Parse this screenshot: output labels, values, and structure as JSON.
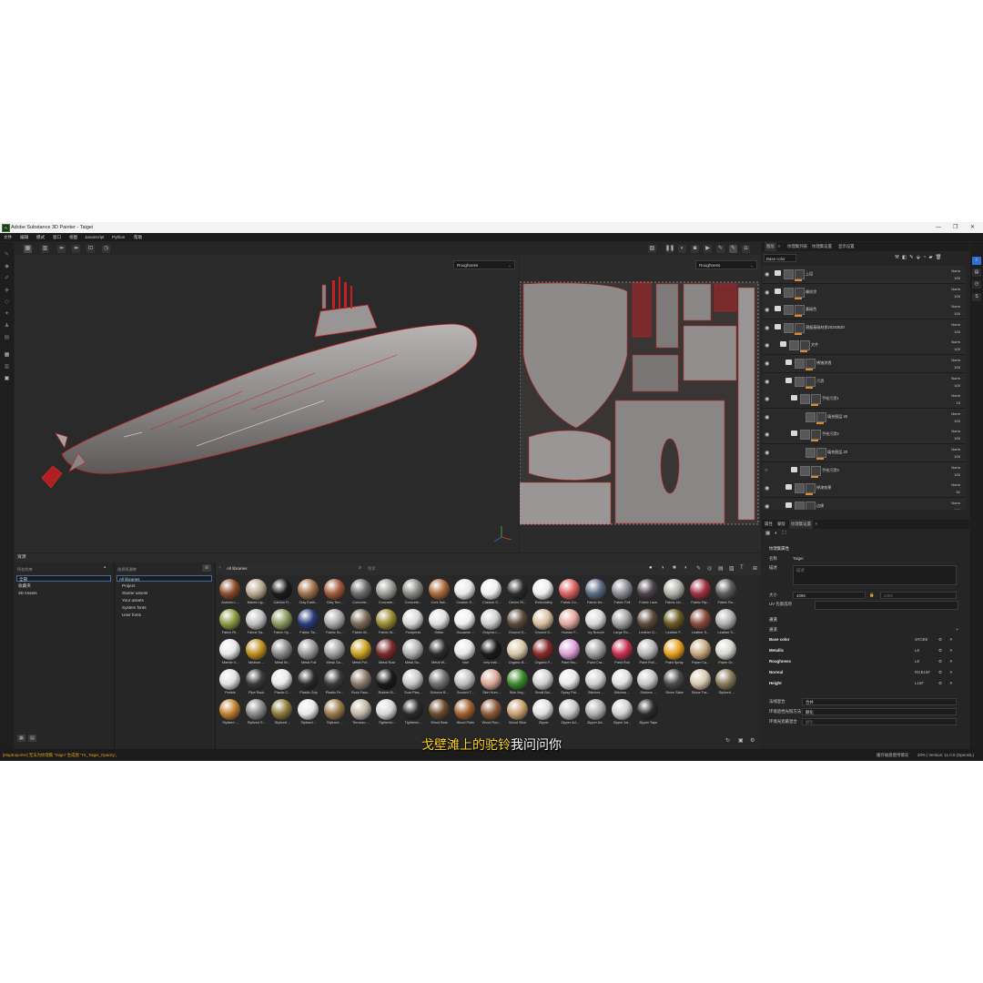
{
  "window": {
    "title": "Adobe Substance 3D Painter - Taigei",
    "logo": "Pt",
    "controls": [
      "—",
      "❐",
      "✕"
    ]
  },
  "menu": [
    "文件",
    "编辑",
    "模式",
    "窗口",
    "视图",
    "JavaScript",
    "Python",
    "帮助"
  ],
  "viewport": {
    "left_channel": "Roughness",
    "right_channel": "Roughness"
  },
  "layers_panel": {
    "tabs": [
      "图层",
      "纹理集列表",
      "纹理集设置",
      "显示设置"
    ],
    "channel": "Base color",
    "layers": [
      {
        "name": "上层",
        "blend": "Norm",
        "opacity": "100"
      },
      {
        "name": "栅纹涂",
        "blend": "Norm",
        "opacity": "100"
      },
      {
        "name": "基础色",
        "blend": "Norm",
        "opacity": "100"
      },
      {
        "name": "潜艇基础材质20240520",
        "blend": "Norm",
        "opacity": "100"
      },
      {
        "name": "文件",
        "blend": "Norm",
        "opacity": "100"
      },
      {
        "name": "锈蚀渗透",
        "blend": "Norm",
        "opacity": "100"
      },
      {
        "name": "污渍",
        "blend": "Norm",
        "opacity": "100"
      },
      {
        "name": "手绘污渍1",
        "blend": "Norm",
        "opacity": "10"
      },
      {
        "name": "填充图层 20",
        "blend": "Norm",
        "opacity": "100"
      },
      {
        "name": "手绘污渍2",
        "blend": "Norm",
        "opacity": "100"
      },
      {
        "name": "填充图层 20",
        "blend": "Norm",
        "opacity": "100"
      },
      {
        "name": "手绘污渍3",
        "blend": "Norm",
        "opacity": "100"
      },
      {
        "name": "掉漆效果",
        "blend": "Norm",
        "opacity": "51"
      },
      {
        "name": "边缘",
        "blend": "Norm",
        "opacity": "100"
      }
    ]
  },
  "texture_set": {
    "tabs": [
      "属性",
      "蒙版",
      "纹理集设置"
    ],
    "section_title": "纹理集属性",
    "name_label": "名称",
    "name_value": "Taigei",
    "desc_label": "描述",
    "desc_placeholder": "描述",
    "size_label": "大小",
    "size_value": "4096",
    "size_value2": "4096",
    "uv_label": "UV 包裹选项",
    "channels_title": "通道",
    "channels_sub": "通道",
    "channels": [
      {
        "name": "Base color",
        "format": "sRGB8"
      },
      {
        "name": "Metallic",
        "format": "L8"
      },
      {
        "name": "Roughness",
        "format": "L8"
      },
      {
        "name": "Normal",
        "format": "RGB16F"
      },
      {
        "name": "Height",
        "format": "L16F"
      }
    ],
    "opt1_label": "法线混合",
    "opt1_value": "合并",
    "opt2_label": "环境遮挡光照方法",
    "opt2_value": "颠化",
    "opt3_label": "环境光遮蔽混合",
    "opt3_value": "颠化"
  },
  "assets": {
    "panel_title": "资源",
    "col1_head": "所在的库",
    "col1_items": [
      "全部",
      "收藏夹",
      "3D Assets"
    ],
    "col2_head": "选择资源库",
    "col2_items": [
      "All libraries",
      "Project",
      "Starter assets",
      "Your assets",
      "System fonts",
      "User fonts"
    ],
    "breadcrumb": "All libraries",
    "search_placeholder": "搜索",
    "materials": [
      {
        "label": "Autumn L...",
        "color": "#8a4a2a"
      },
      {
        "label": "Baked Lig...",
        "color": "#b8a890"
      },
      {
        "label": "Carbon Fi...",
        "color": "#1a1a1a"
      },
      {
        "label": "Clay Earth...",
        "color": "#a0704a"
      },
      {
        "label": "Clay Terr...",
        "color": "#a0583a"
      },
      {
        "label": "Concrete...",
        "color": "#6a6a6a"
      },
      {
        "label": "Concrete...",
        "color": "#9a9a94"
      },
      {
        "label": "Concrete...",
        "color": "#8a8a84"
      },
      {
        "label": "Cork Nat...",
        "color": "#a8683a"
      },
      {
        "label": "Custom S...",
        "color": "#e8e8e8"
      },
      {
        "label": "Custom S...",
        "color": "#f0f0f0"
      },
      {
        "label": "Denim Ri...",
        "color": "#2a2a2a"
      },
      {
        "label": "Embroidery",
        "color": "#eeeeee"
      },
      {
        "label": "Fabric Co...",
        "color": "#d86060"
      },
      {
        "label": "Fabric De...",
        "color": "#5a6a80"
      },
      {
        "label": "Fabric Felt",
        "color": "#8a8a94"
      },
      {
        "label": "Fabric Lace",
        "color": "#4a4248"
      },
      {
        "label": "Fabric Lin...",
        "color": "#b0b0a8"
      },
      {
        "label": "Fabric Rip...",
        "color": "#a03040"
      },
      {
        "label": "Fabric Ro...",
        "color": "#5a5a5a"
      },
      {
        "label": "Fabric Ri...",
        "color": "#8a9a40"
      },
      {
        "label": "Fabric Sa...",
        "color": "#c0c0c0"
      },
      {
        "label": "Fabric Sp...",
        "color": "#8a9a60"
      },
      {
        "label": "Fabric Tw...",
        "color": "#2a3a7a"
      },
      {
        "label": "Fabric Sc...",
        "color": "#aaaaaa"
      },
      {
        "label": "Fabric W...",
        "color": "#7a6a5a"
      },
      {
        "label": "Fabric W...",
        "color": "#9a8a30"
      },
      {
        "label": "Footprints",
        "color": "#d8d8d8"
      },
      {
        "label": "Glitter",
        "color": "#e0e0e0"
      },
      {
        "label": "Gouache ...",
        "color": "#f0f0f0"
      },
      {
        "label": "Graphic L...",
        "color": "#d0d0d0"
      },
      {
        "label": "Ground G...",
        "color": "#5a4a3a"
      },
      {
        "label": "Ground S...",
        "color": "#d8c0a0"
      },
      {
        "label": "Human F...",
        "color": "#e0a8a0"
      },
      {
        "label": "Ivy Branch",
        "color": "#d8d8d8"
      },
      {
        "label": "Large Ro...",
        "color": "#a0a0a0"
      },
      {
        "label": "Leather G...",
        "color": "#5a4a3a"
      },
      {
        "label": "Leather F...",
        "color": "#6a5a20"
      },
      {
        "label": "Leather S...",
        "color": "#8a4a3a"
      },
      {
        "label": "Leather S...",
        "color": "#b0b0b0"
      },
      {
        "label": "Marble V...",
        "color": "#e8e8e8"
      },
      {
        "label": "Medium ...",
        "color": "#c09020"
      },
      {
        "label": "Metal Br...",
        "color": "#8a8a8a"
      },
      {
        "label": "Metal Foil",
        "color": "#9a9a9a"
      },
      {
        "label": "Metal Ga...",
        "color": "#a0a0a0"
      },
      {
        "label": "Metal Pol...",
        "color": "#c8a020"
      },
      {
        "label": "Metal Rust",
        "color": "#7a2a2a"
      },
      {
        "label": "Metal Sa...",
        "color": "#b0b0b0"
      },
      {
        "label": "Metal W...",
        "color": "#2a2a2a"
      },
      {
        "label": "Nail",
        "color": "#e8e8e8"
      },
      {
        "label": "new mat...",
        "color": "#1a1a1a"
      },
      {
        "label": "Organic B...",
        "color": "#d8c8a8"
      },
      {
        "label": "Organic F...",
        "color": "#8a2a2a"
      },
      {
        "label": "Paint Bru...",
        "color": "#e0a0d8"
      },
      {
        "label": "Paint Cra...",
        "color": "#a0a0a0"
      },
      {
        "label": "Paint Roll",
        "color": "#c83050"
      },
      {
        "label": "Paint Roll...",
        "color": "#b8b8b8"
      },
      {
        "label": "Paint Spray",
        "color": "#e8a020"
      },
      {
        "label": "Paper Ca...",
        "color": "#c8a880"
      },
      {
        "label": "Paper Gr...",
        "color": "#d8d8d0"
      },
      {
        "label": "Pebble",
        "color": "#e0e0e0"
      },
      {
        "label": "Pipe Rack",
        "color": "#3a3a3a"
      },
      {
        "label": "Plastic C...",
        "color": "#e8e8e8"
      },
      {
        "label": "Plastic Grip",
        "color": "#2a2a2a"
      },
      {
        "label": "Plastic Fe...",
        "color": "#3a3a3a"
      },
      {
        "label": "Rock Fasc...",
        "color": "#8a7a6a"
      },
      {
        "label": "Rubber B...",
        "color": "#1a1a1a"
      },
      {
        "label": "Scar Plas...",
        "color": "#c8c8c8"
      },
      {
        "label": "Science B...",
        "color": "#707070"
      },
      {
        "label": "Scratch T...",
        "color": "#c0c0c0"
      },
      {
        "label": "Skin Hum...",
        "color": "#d8a898"
      },
      {
        "label": "Skin Veg...",
        "color": "#3a8a2a"
      },
      {
        "label": "Small Bol...",
        "color": "#d0d0d0"
      },
      {
        "label": "Spray Pai...",
        "color": "#e8e8e8"
      },
      {
        "label": "Stitches ...",
        "color": "#d0d0d0"
      },
      {
        "label": "Stitches ...",
        "color": "#e0e0e0"
      },
      {
        "label": "Stickers ...",
        "color": "#c8c8c8"
      },
      {
        "label": "Stone Slate",
        "color": "#4a4a4a"
      },
      {
        "label": "Stone Tra...",
        "color": "#d8c8b0"
      },
      {
        "label": "Stylized ...",
        "color": "#8a7a5a"
      },
      {
        "label": "Stylized ...",
        "color": "#c08030"
      },
      {
        "label": "Stylized S...",
        "color": "#8a8a8a"
      },
      {
        "label": "Stylized ...",
        "color": "#8a7a3a"
      },
      {
        "label": "Stylized ...",
        "color": "#e8e8e8"
      },
      {
        "label": "Stylized ...",
        "color": "#9a7a4a"
      },
      {
        "label": "Terrazzo ...",
        "color": "#c0b8a8"
      },
      {
        "label": "Tightenin...",
        "color": "#d8d8d8"
      },
      {
        "label": "Tightenin...",
        "color": "#2a2a2a"
      },
      {
        "label": "Wood Bark",
        "color": "#6a4a2a"
      },
      {
        "label": "Wood Plain",
        "color": "#a06030"
      },
      {
        "label": "Wood Rou...",
        "color": "#8a5a3a"
      },
      {
        "label": "Wood Slice",
        "color": "#c8a070"
      },
      {
        "label": "Zipper",
        "color": "#e0e0e0"
      },
      {
        "label": "Zipper Ad...",
        "color": "#c8c8c8"
      },
      {
        "label": "Zipper Ad...",
        "color": "#b0b0b0"
      },
      {
        "label": "Zipper Ad...",
        "color": "#d0d0d0"
      },
      {
        "label": "Zipper Tape",
        "color": "#2a2a2a"
      }
    ]
  },
  "status": {
    "log": "[MapExporter] 无法为纹理集 'Taigei' 生成图 'TX_Taigei_Opacity'。",
    "right1": "缓存磁盘使用情况",
    "right2": "20% | Version: 11.0.0 (OpenGL)"
  },
  "subtitle": {
    "highlight": "戈壁滩上的驼铃",
    "rest": "我问问你"
  },
  "colors": {
    "accent": "#3a6ea5",
    "layer_bar": "#e08a2e",
    "wire": "#c82020"
  }
}
